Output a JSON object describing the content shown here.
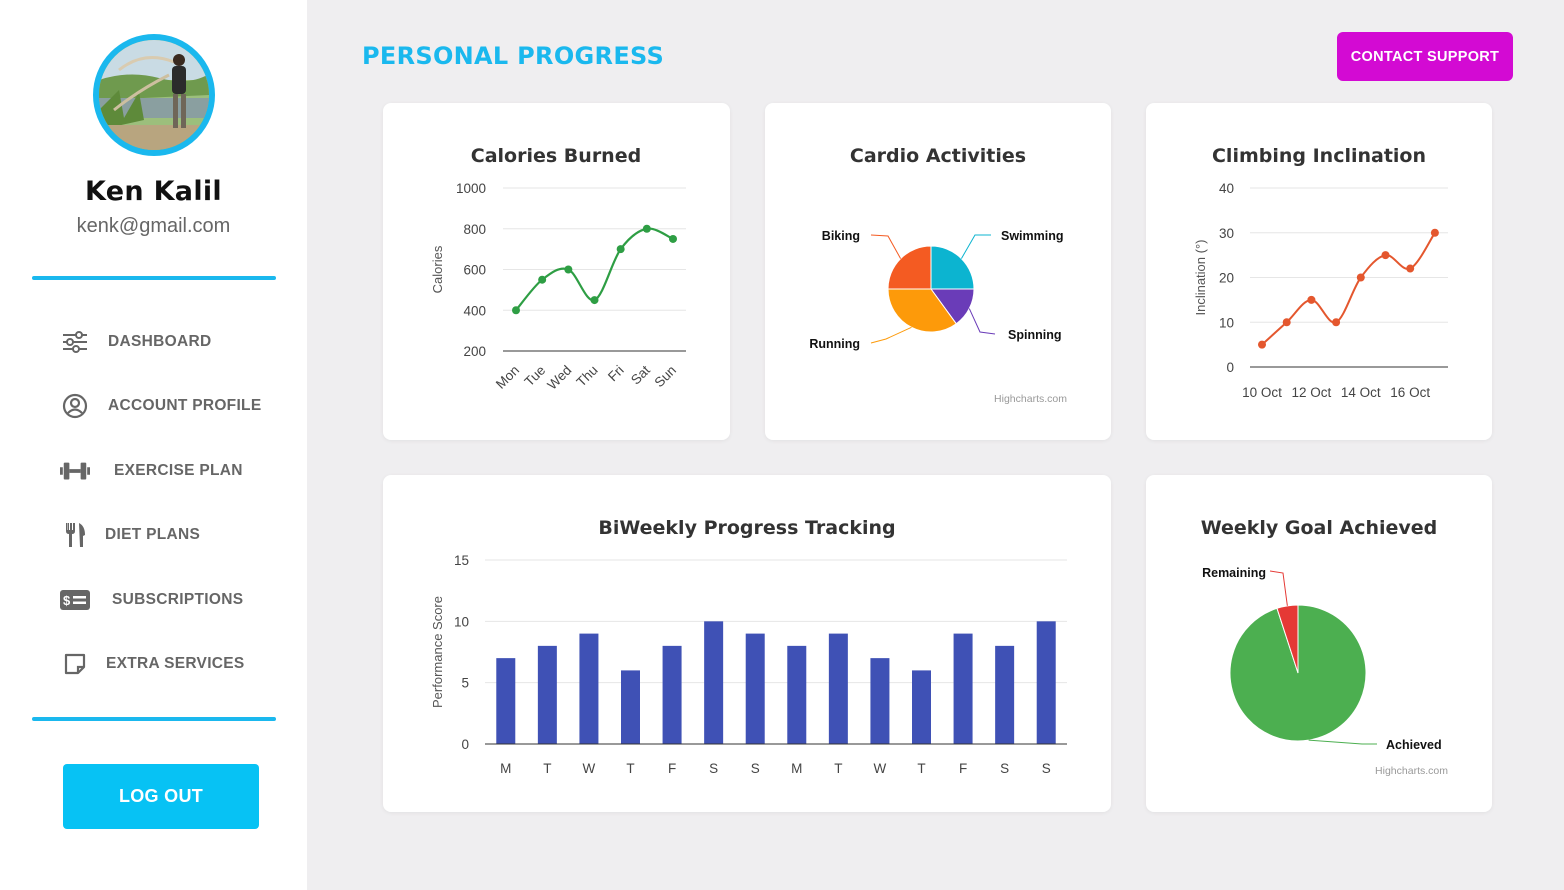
{
  "user": {
    "name": "Ken Kalil",
    "email": "kenk@gmail.com"
  },
  "sidebar": {
    "items": [
      {
        "label": "DASHBOARD",
        "icon": "sliders-icon"
      },
      {
        "label": "ACCOUNT PROFILE",
        "icon": "user-circle-icon"
      },
      {
        "label": "EXERCISE PLAN",
        "icon": "dumbbell-icon"
      },
      {
        "label": "DIET PLANS",
        "icon": "fork-knife-icon"
      },
      {
        "label": "SUBSCRIPTIONS",
        "icon": "money-card-icon"
      },
      {
        "label": "EXTRA SERVICES",
        "icon": "note-icon"
      }
    ],
    "logout_label": "LOG OUT"
  },
  "header": {
    "title": "PERSONAL PROGRESS",
    "contact_label": "CONTACT SUPPORT"
  },
  "colors": {
    "accent": "#1ab8ee",
    "support": "#d30ad3",
    "logout": "#07c2f4"
  },
  "chart_data": [
    {
      "type": "line",
      "title": "Calories Burned",
      "ylabel": "Calories",
      "categories": [
        "Mon",
        "Tue",
        "Wed",
        "Thu",
        "Fri",
        "Sat",
        "Sun"
      ],
      "series": [
        {
          "values": [
            400,
            550,
            600,
            450,
            700,
            800,
            750
          ],
          "color": "#2e9e44"
        }
      ],
      "yticks": [
        200,
        400,
        600,
        800,
        1000
      ],
      "ylim": [
        200,
        1000
      ],
      "grid": true
    },
    {
      "type": "pie",
      "title": "Cardio Activities",
      "slices": [
        {
          "label": "Swimming",
          "value": 25,
          "color": "#0cb4d0"
        },
        {
          "label": "Spinning",
          "value": 15,
          "color": "#6a3cb8"
        },
        {
          "label": "Running",
          "value": 35,
          "color": "#fd9a0a"
        },
        {
          "label": "Biking",
          "value": 25,
          "color": "#f45b22"
        }
      ],
      "credit": "Highcharts.com"
    },
    {
      "type": "line",
      "title": "Climbing Inclination",
      "ylabel": "Inclination (°)",
      "x": [
        "10 Oct",
        "11 Oct",
        "12 Oct",
        "13 Oct",
        "14 Oct",
        "15 Oct",
        "16 Oct",
        "17 Oct"
      ],
      "xticks": [
        "10 Oct",
        "12 Oct",
        "14 Oct",
        "16 Oct"
      ],
      "series": [
        {
          "values": [
            5,
            10,
            15,
            10,
            20,
            25,
            22,
            30
          ],
          "color": "#e4572e"
        }
      ],
      "yticks": [
        0,
        10,
        20,
        30,
        40
      ],
      "ylim": [
        0,
        40
      ],
      "grid": true
    },
    {
      "type": "bar",
      "title": "BiWeekly Progress Tracking",
      "ylabel": "Performance Score",
      "categories": [
        "M",
        "T",
        "W",
        "T",
        "F",
        "S",
        "S",
        "M",
        "T",
        "W",
        "T",
        "F",
        "S",
        "S"
      ],
      "series": [
        {
          "values": [
            7,
            8,
            9,
            6,
            8,
            10,
            9,
            8,
            9,
            7,
            6,
            9,
            8,
            10
          ],
          "color": "#3f51b5"
        }
      ],
      "yticks": [
        0,
        5,
        10,
        15
      ],
      "ylim": [
        0,
        15
      ],
      "grid": true
    },
    {
      "type": "pie",
      "title": "Weekly Goal Achieved",
      "slices": [
        {
          "label": "Achieved",
          "value": 95,
          "color": "#4caf50"
        },
        {
          "label": "Remaining",
          "value": 5,
          "color": "#e53935"
        }
      ],
      "credit": "Highcharts.com"
    }
  ]
}
